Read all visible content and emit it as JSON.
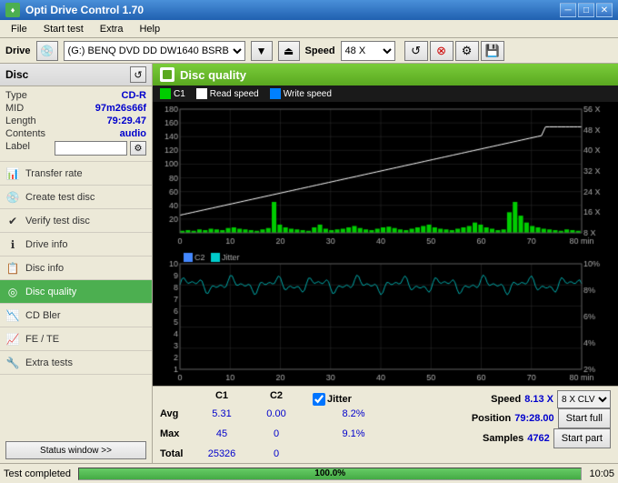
{
  "titleBar": {
    "title": "Opti Drive Control 1.70",
    "icon": "♦"
  },
  "menu": {
    "items": [
      "File",
      "Start test",
      "Extra",
      "Help"
    ]
  },
  "driveBar": {
    "driveLabel": "Drive",
    "driveValue": "(G:) BENQ DVD DD DW1640 BSRB",
    "speedLabel": "Speed",
    "speedValue": "48 X"
  },
  "disc": {
    "title": "Disc",
    "fields": {
      "type": {
        "key": "Type",
        "value": "CD-R"
      },
      "mid": {
        "key": "MID",
        "value": "97m26s66f"
      },
      "length": {
        "key": "Length",
        "value": "79:29.47"
      },
      "contents": {
        "key": "Contents",
        "value": "audio"
      },
      "label": {
        "key": "Label",
        "value": ""
      }
    }
  },
  "nav": {
    "items": [
      {
        "id": "transfer-rate",
        "label": "Transfer rate",
        "icon": "📊"
      },
      {
        "id": "create-test-disc",
        "label": "Create test disc",
        "icon": "💿"
      },
      {
        "id": "verify-test-disc",
        "label": "Verify test disc",
        "icon": "✔"
      },
      {
        "id": "drive-info",
        "label": "Drive info",
        "icon": "ℹ"
      },
      {
        "id": "disc-info",
        "label": "Disc info",
        "icon": "📋"
      },
      {
        "id": "disc-quality",
        "label": "Disc quality",
        "icon": "◎",
        "active": true
      },
      {
        "id": "cd-bler",
        "label": "CD Bler",
        "icon": "📉"
      },
      {
        "id": "fe-te",
        "label": "FE / TE",
        "icon": "📈"
      },
      {
        "id": "extra-tests",
        "label": "Extra tests",
        "icon": "🔧"
      }
    ]
  },
  "statusWindow": {
    "label": "Status window >>"
  },
  "chart": {
    "title": "Disc quality",
    "legend": {
      "c1": "C1",
      "readSpeed": "Read speed",
      "writeSpeed": "Write speed"
    },
    "topChart": {
      "yMax": 180,
      "yLabels": [
        "180",
        "160",
        "140",
        "120",
        "100",
        "80",
        "60",
        "40",
        "20"
      ],
      "xLabels": [
        "0",
        "10",
        "20",
        "30",
        "40",
        "50",
        "60",
        "70",
        "80 min"
      ],
      "rightLabels": [
        "56 X",
        "48 X",
        "40 X",
        "32 X",
        "24 X",
        "16 X",
        "8 X"
      ]
    },
    "bottomChart": {
      "yMax": 10,
      "yLabels": [
        "10",
        "9",
        "8",
        "7",
        "6",
        "5",
        "4",
        "3",
        "2",
        "1"
      ],
      "xLabels": [
        "0",
        "10",
        "20",
        "30",
        "40",
        "50",
        "60",
        "70",
        "80 min"
      ],
      "rightLabels": [
        "10%",
        "8%",
        "6%",
        "4%",
        "2%"
      ],
      "c2Label": "C2",
      "jitterLabel": "Jitter"
    }
  },
  "stats": {
    "columns": {
      "c1": "C1",
      "c2": "C2",
      "jitter": "Jitter"
    },
    "rows": {
      "avg": {
        "label": "Avg",
        "c1": "5.31",
        "c2": "0.00",
        "jitter": "8.2%"
      },
      "max": {
        "label": "Max",
        "c1": "45",
        "c2": "0",
        "jitter": "9.1%"
      },
      "total": {
        "label": "Total",
        "c1": "25326",
        "c2": "0"
      }
    },
    "jitterChecked": true,
    "speed": {
      "label": "Speed",
      "value": "8.13 X"
    },
    "position": {
      "label": "Position",
      "value": "79:28.00"
    },
    "samples": {
      "label": "Samples",
      "value": "4762"
    },
    "clvOption": "8 X CLV",
    "startFull": "Start full",
    "startPart": "Start part"
  },
  "statusBar": {
    "text": "Test completed",
    "progress": 100,
    "progressText": "100.0%",
    "time": "10:05"
  }
}
